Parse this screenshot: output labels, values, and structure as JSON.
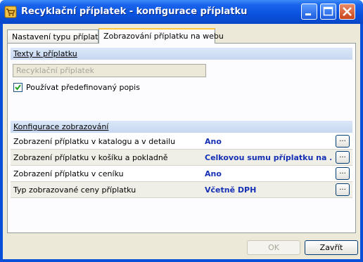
{
  "window": {
    "title": "Recyklační příplatek - konfigurace příplatku"
  },
  "tabs": [
    {
      "label": "Nastavení typu příplatku",
      "active": false
    },
    {
      "label": "Zobrazování příplatku na webu",
      "active": true
    }
  ],
  "texts_section": {
    "header": "Texty k příplatku",
    "text_value": "Recyklační příplatek",
    "checkbox_label": "Používat předefinovaný popis",
    "checkbox_checked": true
  },
  "display_section": {
    "header": "Konfigurace zobrazování",
    "rows": [
      {
        "label": "Zobrazení příplatku v katalogu a v detailu",
        "value": "Ano",
        "button": "..."
      },
      {
        "label": "Zobrazení příplatku v košíku a pokladně",
        "value": "Celkovou sumu příplatku na ...",
        "button": "..."
      },
      {
        "label": "Zobrazení příplatku v ceníku",
        "value": "Ano",
        "button": "..."
      },
      {
        "label": "Typ zobrazované ceny příplatku",
        "value": "Včetně DPH",
        "button": "..."
      }
    ]
  },
  "buttons": {
    "ok": "OK",
    "close": "Zavřít"
  },
  "colors": {
    "titlebar": "#0a52de",
    "value_text": "#1530b5",
    "section_header": "#c6d7f0"
  }
}
